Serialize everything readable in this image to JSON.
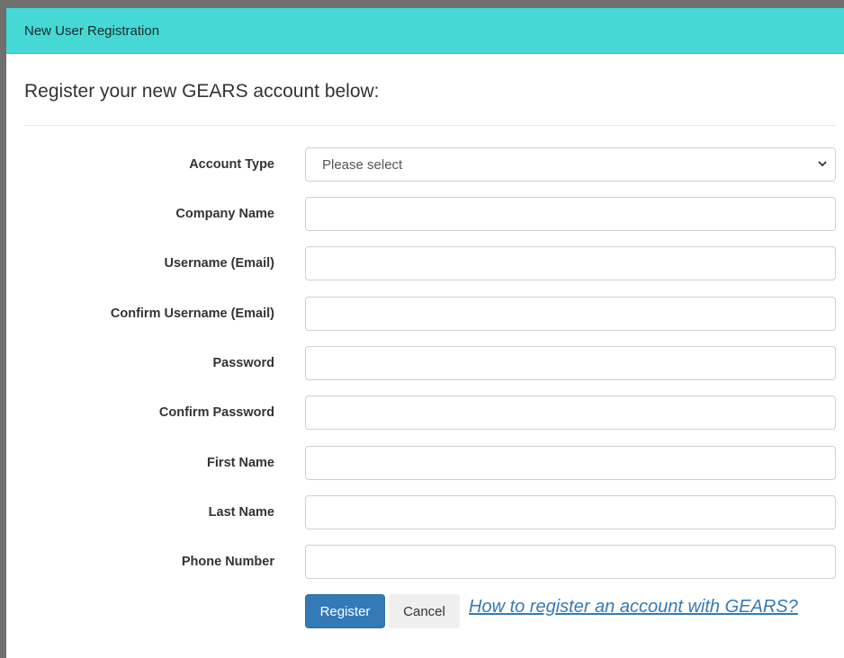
{
  "window": {
    "title": "New User Registration"
  },
  "heading": "Register your new GEARS account below:",
  "form": {
    "account_type": {
      "label": "Account Type",
      "selected": "Please select"
    },
    "company_name": {
      "label": "Company Name",
      "value": ""
    },
    "username": {
      "label": "Username (Email)",
      "value": ""
    },
    "confirm_username": {
      "label": "Confirm Username (Email)",
      "value": ""
    },
    "password": {
      "label": "Password",
      "value": ""
    },
    "confirm_password": {
      "label": "Confirm Password",
      "value": ""
    },
    "first_name": {
      "label": "First Name",
      "value": ""
    },
    "last_name": {
      "label": "Last Name",
      "value": ""
    },
    "phone_number": {
      "label": "Phone Number",
      "value": ""
    }
  },
  "actions": {
    "register_label": "Register",
    "cancel_label": "Cancel",
    "help_link": "How to register an account with GEARS?"
  },
  "icons": {
    "select_arrow": "chevron-down-icon"
  },
  "colors": {
    "header_bg": "#46d8d5",
    "primary_button": "#337ab7",
    "link": "#337ab7"
  }
}
